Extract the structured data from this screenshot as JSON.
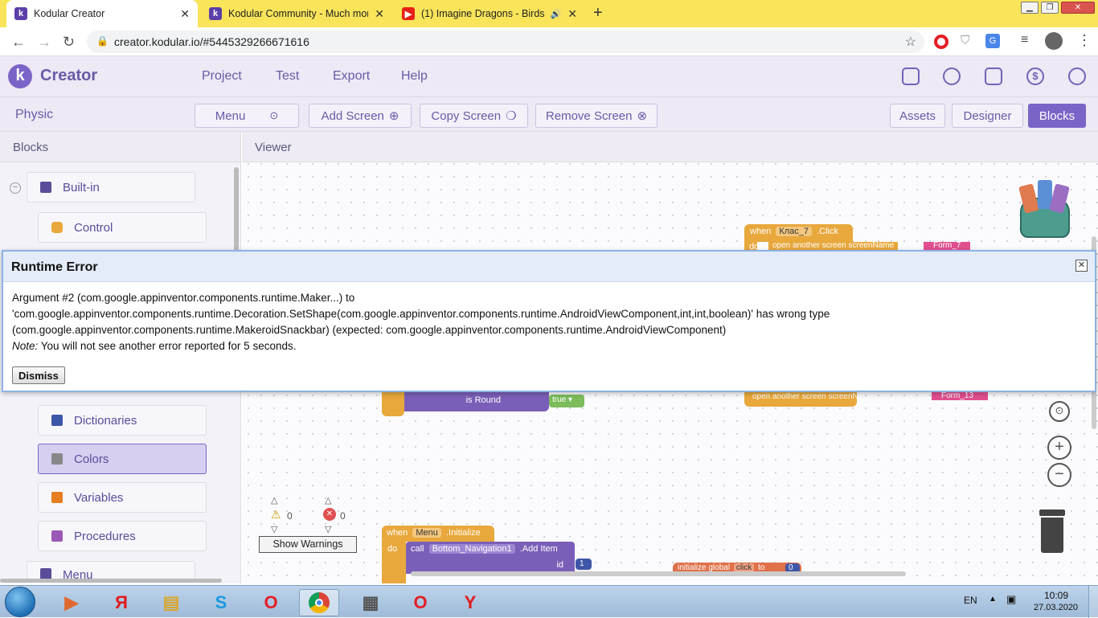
{
  "browser": {
    "tabs": [
      {
        "title": "Kodular Creator",
        "icon": "kodular-icon",
        "active": true
      },
      {
        "title": "Kodular Community - Much mor",
        "icon": "kodular-icon",
        "active": false
      },
      {
        "title": "(1) Imagine Dragons - Birds (",
        "icon": "youtube-icon",
        "active": false
      }
    ],
    "url": "creator.kodular.io/#5445329266671616"
  },
  "app": {
    "brand": "Creator",
    "menu": [
      "Project",
      "Test",
      "Export",
      "Help"
    ],
    "project_name": "Physic",
    "screen_menu": "Menu",
    "add_screen": "Add Screen",
    "copy_screen": "Copy Screen",
    "remove_screen": "Remove Screen",
    "view_assets": "Assets",
    "view_designer": "Designer",
    "view_blocks": "Blocks"
  },
  "blocks_panel": {
    "title": "Blocks",
    "builtin": "Built-in",
    "categories": [
      "Control",
      "Dictionaries",
      "Colors",
      "Variables",
      "Procedures"
    ],
    "next_group": "Menu",
    "selected": "Colors"
  },
  "viewer": {
    "title": "Viewer",
    "warnings_count": "0",
    "errors_count": "0",
    "show_warnings": "Show Warnings",
    "blocks": {
      "b1_when": "when",
      "b1_comp": "Клас_7",
      "b1_event": ".Click",
      "b1_do": "do",
      "b1_call": "open another screen  screenName",
      "b1_value": "Form_7",
      "b2_is_round": "is Round",
      "b2_true": "true",
      "b3_call": "open another screen  screenName",
      "b3_value": "Form_13",
      "b4_when": "when",
      "b4_comp": "Menu",
      "b4_event": ".Initialize",
      "b4_do": "do",
      "b4_call": "call",
      "b4_target": "Bottom_Navigation1",
      "b4_method": ".Add Item",
      "b4_id": "id",
      "b4_id_value": "1",
      "b5_init": "initialize global",
      "b5_name": "click",
      "b5_to": "to",
      "b5_value": "0"
    }
  },
  "dialog": {
    "title": "Runtime Error",
    "line1": "Argument #2 (com.google.appinventor.components.runtime.Maker...) to",
    "line2": "'com.google.appinventor.components.runtime.Decoration.SetShape(com.google.appinventor.components.runtime.AndroidViewComponent,int,int,boolean)' has wrong type",
    "line3": "(com.google.appinventor.components.runtime.MakeroidSnackbar) (expected: com.google.appinventor.components.runtime.AndroidViewComponent)",
    "note_label": "Note:",
    "note_text": " You will not see another error reported for 5 seconds.",
    "dismiss": "Dismiss"
  },
  "taskbar": {
    "lang": "EN",
    "time": "10:09",
    "date": "27.03.2020"
  },
  "colors": {
    "tab_bar": "#f9e45a",
    "accent": "#7b64c7",
    "dialog_header": "#e4ecf9"
  }
}
